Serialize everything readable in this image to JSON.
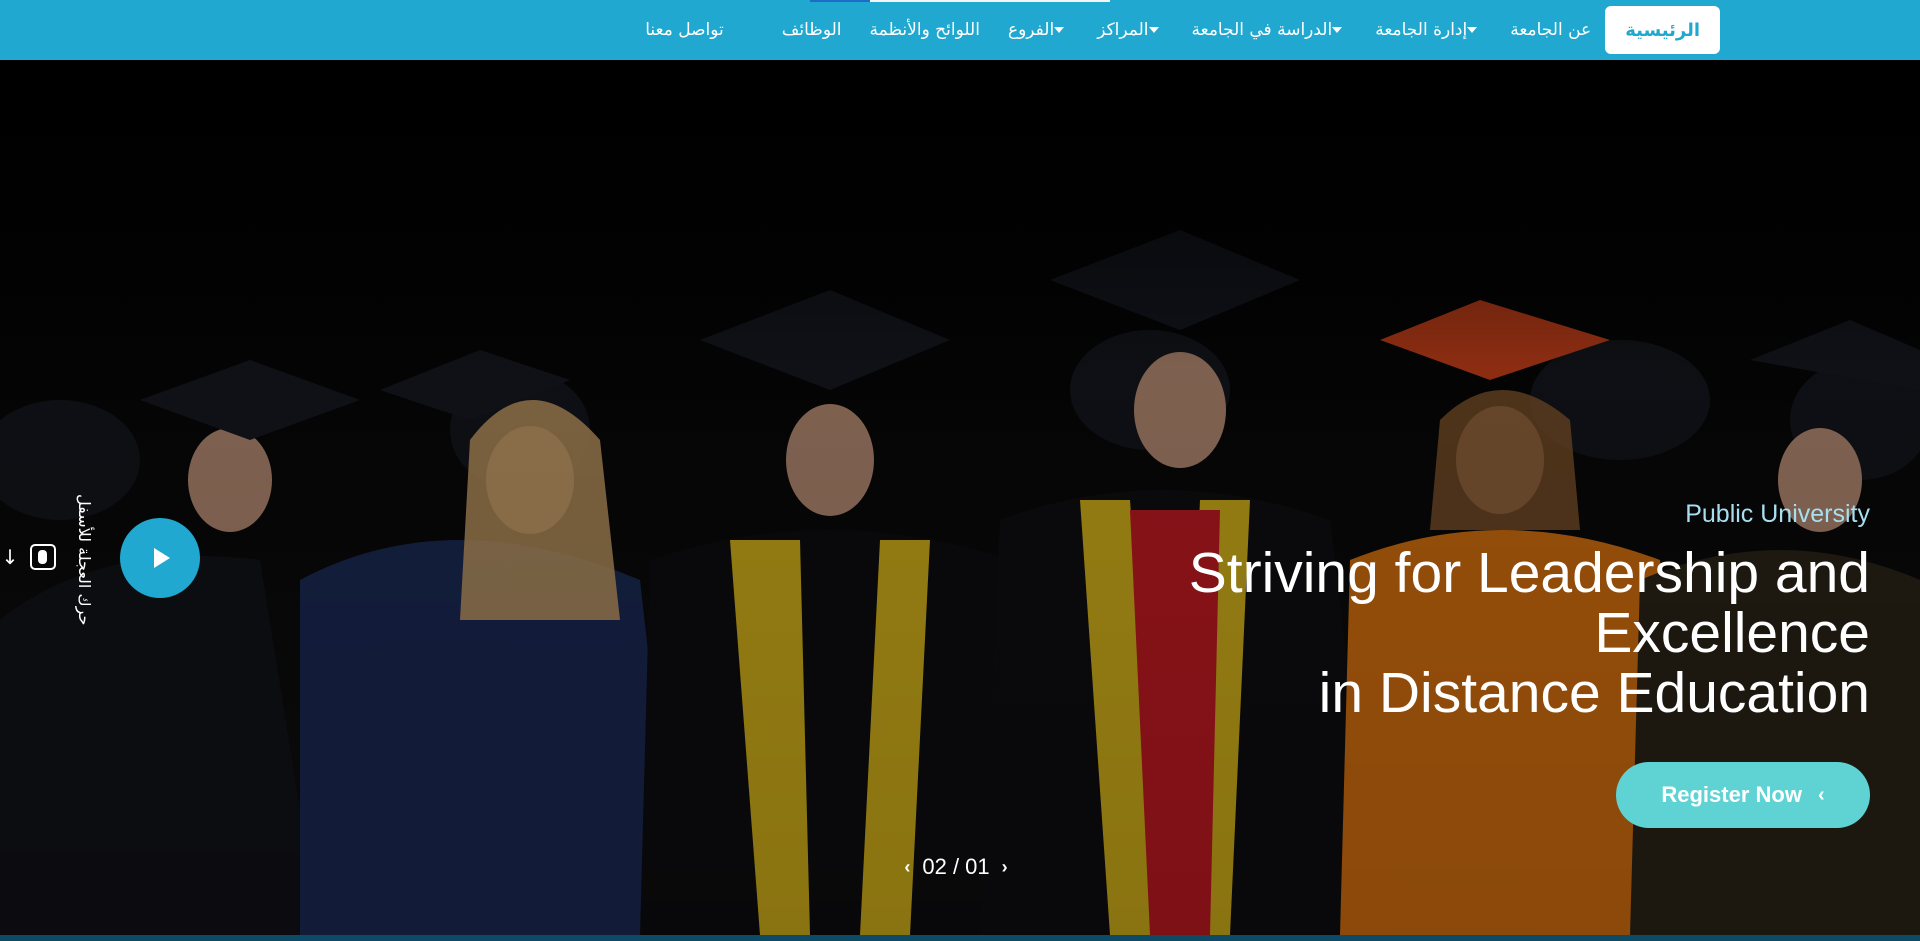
{
  "nav": {
    "items": [
      {
        "label": "الرئيسية",
        "active": true,
        "dropdown": false
      },
      {
        "label": "عن الجامعة",
        "active": false,
        "dropdown": false
      },
      {
        "label": "إدارة الجامعة",
        "active": false,
        "dropdown": true
      },
      {
        "label": "الدراسة في الجامعة",
        "active": false,
        "dropdown": true
      },
      {
        "label": "المراكز",
        "active": false,
        "dropdown": true
      },
      {
        "label": "الفروع",
        "active": false,
        "dropdown": true
      },
      {
        "label": "اللوائح والأنظمة",
        "active": false,
        "dropdown": false
      },
      {
        "label": "الوظائف",
        "active": false,
        "dropdown": false
      },
      {
        "label": "تواصل معنا",
        "active": false,
        "dropdown": false
      }
    ]
  },
  "hero": {
    "subtitle": "Public University",
    "title_line1": "Striving for Leadership and",
    "title_line2": "Excellence",
    "title_line3": "in Distance Education",
    "register_label": "Register Now",
    "scroll_hint": "حرك العجلة للأسفل"
  },
  "slider": {
    "page": "02 / 01"
  },
  "colors": {
    "brand": "#20a8d0",
    "accent": "#5fd3d3",
    "subtitle": "#a8dff0"
  }
}
